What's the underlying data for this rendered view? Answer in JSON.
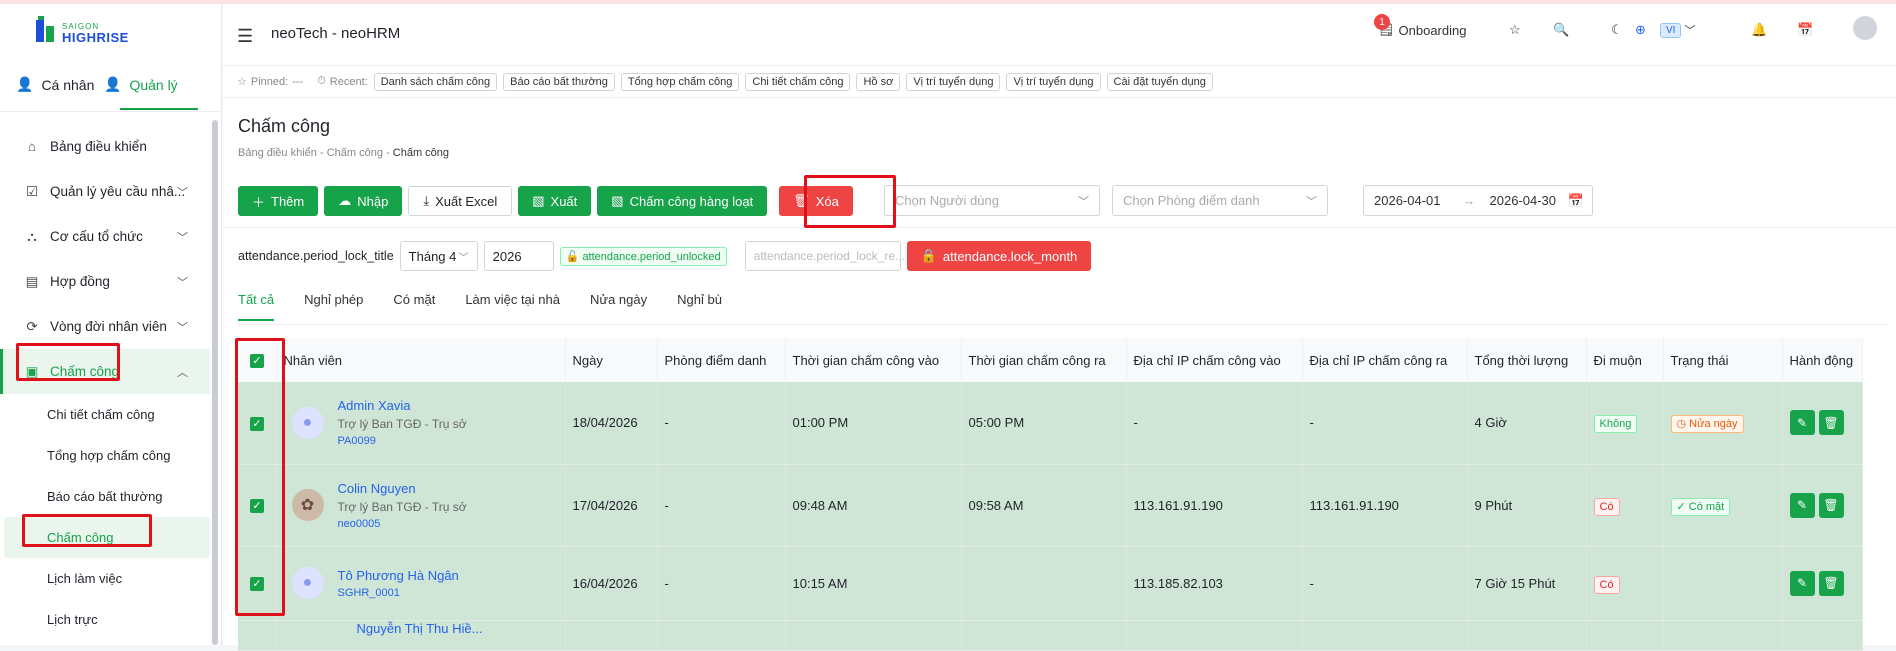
{
  "brand": {
    "line1": "SAIGON",
    "line2": "HIGHRISE"
  },
  "roles": {
    "personal": "Cá nhân",
    "admin": "Quản lý"
  },
  "menu": [
    {
      "label": "Bảng điều khiển",
      "icon": "home-icon"
    },
    {
      "label": "Quản lý yêu cầu nhâ...",
      "icon": "checkbox-icon"
    },
    {
      "label": "Cơ cấu tổ chức",
      "icon": "org-icon"
    },
    {
      "label": "Hợp đồng",
      "icon": "contract-icon"
    },
    {
      "label": "Vòng đời nhân viên",
      "icon": "cycle-icon"
    },
    {
      "label": "Chấm công",
      "icon": "attendance-icon"
    }
  ],
  "submenu": [
    "Chi tiết chấm công",
    "Tổng hợp chấm công",
    "Báo cáo bất thường",
    "Chấm công",
    "Lịch làm việc",
    "Lịch trực"
  ],
  "header": {
    "title": "neoTech - neoHRM",
    "onboarding": "Onboarding",
    "badge": "1",
    "lang": "VI"
  },
  "pinned": {
    "label": "Pinned:",
    "value": "---",
    "recent_label": "Recent:",
    "recent": [
      "Danh sách chấm công",
      "Báo cáo bất thường",
      "Tổng hợp chấm công",
      "Chi tiết chấm công",
      "Hồ sơ",
      "Vị trí tuyển dụng",
      "Vị trí tuyển dụng",
      "Cài đặt tuyển dụng"
    ]
  },
  "page": {
    "title": "Chấm công",
    "crumbs": [
      "Bảng điều khiển",
      "Chấm công",
      "Chấm công"
    ]
  },
  "toolbar": {
    "add": "Thêm",
    "import": "Nhập",
    "export_excel": "Xuất Excel",
    "export": "Xuất",
    "bulk": "Chấm công hàng loạt",
    "delete": "Xóa"
  },
  "filters": {
    "user_placeholder": "Chọn Người dùng",
    "room_placeholder": "Chọn Phòng điểm danh",
    "date_from": "2026-04-01",
    "date_to": "2026-04-30"
  },
  "lock": {
    "title": "attendance.period_lock_title",
    "month": "Tháng 4",
    "year": "2026",
    "status": "attendance.period_unlocked",
    "reason_placeholder": "attendance.period_lock_re...",
    "lock_button": "attendance.lock_month"
  },
  "tabs": [
    "Tất cả",
    "Nghỉ phép",
    "Có mặt",
    "Làm việc tại nhà",
    "Nửa ngày",
    "Nghỉ bù"
  ],
  "columns": [
    "Nhân viên",
    "Ngày",
    "Phòng điểm danh",
    "Thời gian chấm công vào",
    "Thời gian chấm công ra",
    "Địa chỉ IP chấm công vào",
    "Địa chỉ IP chấm công ra",
    "Tổng thời lượng",
    "Đi muộn",
    "Trạng thái",
    "Hành động"
  ],
  "rows": [
    {
      "name": "Admin Xavia",
      "role": "Trợ lý Ban TGĐ - Trụ sở",
      "code": "PA0099",
      "date": "18/04/2026",
      "room": "-",
      "in": "01:00 PM",
      "out": "05:00 PM",
      "ip_in": "-",
      "ip_out": "-",
      "total": "4 Giờ",
      "late": "Không",
      "status": "Nửa ngày"
    },
    {
      "name": "Colin Nguyen",
      "role": "Trợ lý Ban TGĐ - Trụ sở",
      "code": "neo0005",
      "date": "17/04/2026",
      "room": "-",
      "in": "09:48 AM",
      "out": "09:58 AM",
      "ip_in": "113.161.91.190",
      "ip_out": "113.161.91.190",
      "total": "9 Phút",
      "late": "Có",
      "status": "Có mặt"
    },
    {
      "name": "Tô Phương Hà Ngân",
      "role": "",
      "code": "SGHR_0001",
      "date": "16/04/2026",
      "room": "-",
      "in": "10:15 AM",
      "out": "",
      "ip_in": "113.185.82.103",
      "ip_out": "-",
      "total": "7 Giờ 15 Phút",
      "late": "Có",
      "status": ""
    },
    {
      "name": "Nguyễn Thị Thu Hiề...",
      "role": "",
      "code": "",
      "date": "",
      "room": "",
      "in": "",
      "out": "",
      "ip_in": "",
      "ip_out": "",
      "total": "",
      "late": "",
      "status": ""
    }
  ]
}
